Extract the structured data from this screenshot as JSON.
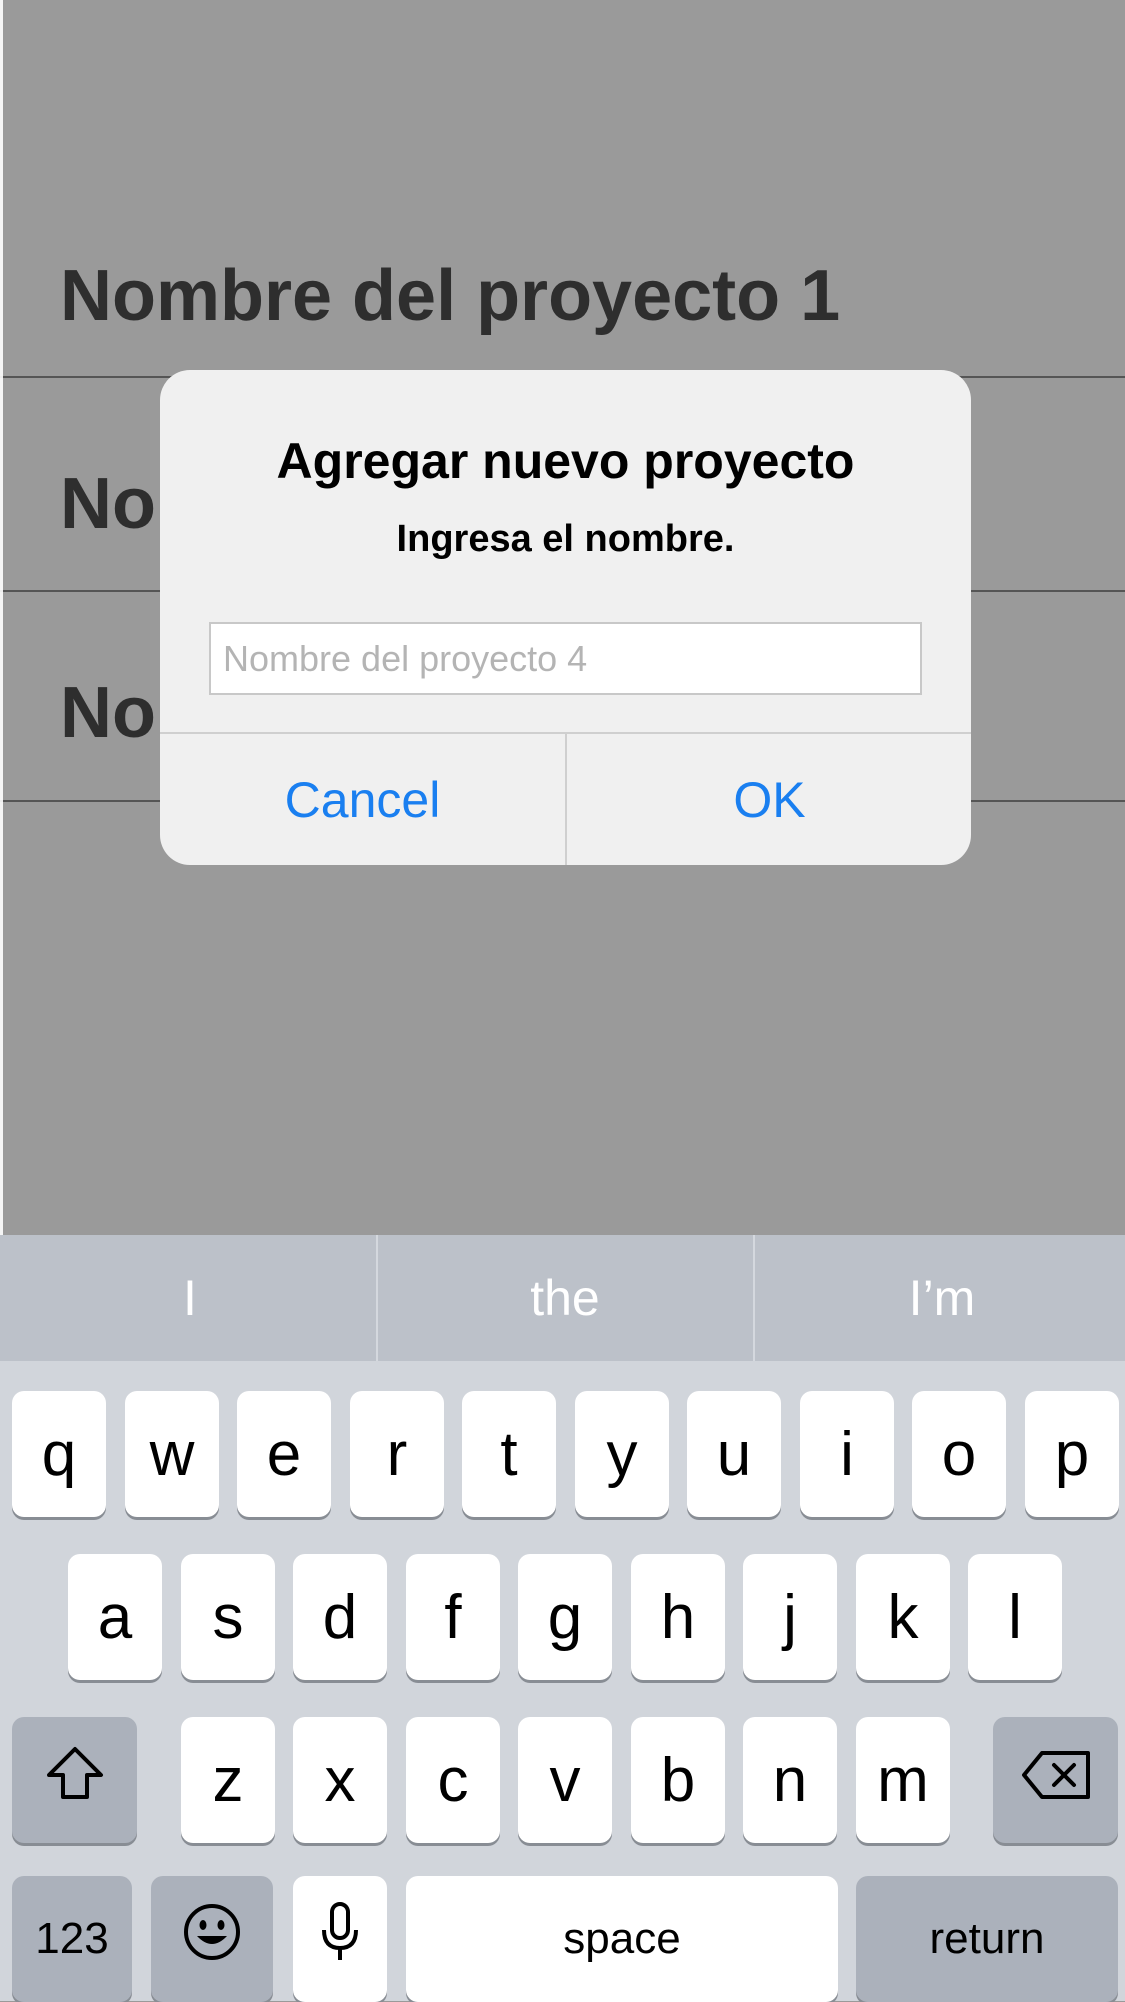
{
  "background_list": {
    "rows": [
      {
        "label": "Nombre del proyecto 1"
      },
      {
        "label": "No"
      },
      {
        "label": "No"
      }
    ]
  },
  "alert": {
    "title": "Agregar nuevo proyecto",
    "message": "Ingresa el nombre.",
    "input": {
      "value": "",
      "placeholder": "Nombre del proyecto 4"
    },
    "cancel_label": "Cancel",
    "ok_label": "OK",
    "accent_color": "#1a7ff0"
  },
  "keyboard": {
    "suggestions": [
      "I",
      "the",
      "I’m"
    ],
    "row1": [
      "q",
      "w",
      "e",
      "r",
      "t",
      "y",
      "u",
      "i",
      "o",
      "p"
    ],
    "row2": [
      "a",
      "s",
      "d",
      "f",
      "g",
      "h",
      "j",
      "k",
      "l"
    ],
    "row3": [
      "z",
      "x",
      "c",
      "v",
      "b",
      "n",
      "m"
    ],
    "numbers_label": "123",
    "space_label": "space",
    "return_label": "return",
    "icons": {
      "shift": "shift-icon",
      "delete": "delete-icon",
      "emoji": "emoji-icon",
      "dictation": "microphone-icon"
    }
  }
}
